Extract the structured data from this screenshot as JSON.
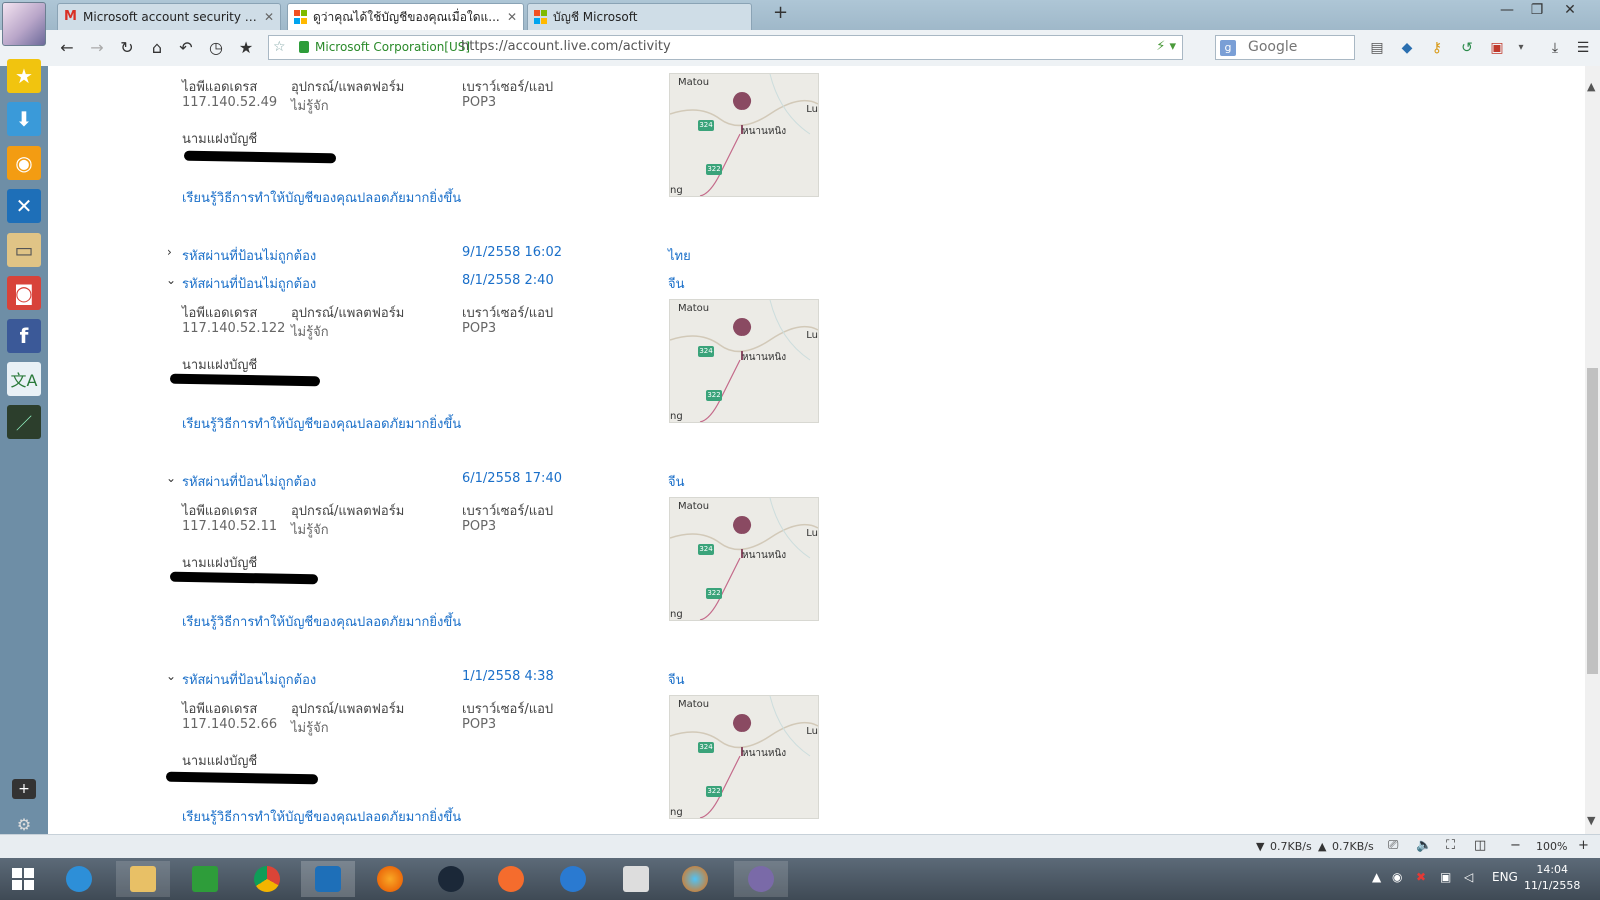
{
  "tabs": [
    {
      "title": "Microsoft account security code...",
      "icon": "gmail-icon"
    },
    {
      "title": "ดูว่าคุณได้ใช้บัญชีของคุณเมื่อใดแ...",
      "icon": "microsoft-logo-icon"
    },
    {
      "title": "บัญชี Microsoft",
      "icon": "microsoft-logo-icon"
    }
  ],
  "address": {
    "site_identity": "Microsoft Corporation[US]",
    "url": "https://account.live.com/activity"
  },
  "search": {
    "placeholder": "Google"
  },
  "activity": {
    "ip_label": "ไอพีแอดเดรส",
    "device_label": "อุปกรณ์/แพลตฟอร์ม",
    "browser_label": "เบราว์เซอร์/แอป",
    "alias_label": "นามแฝงบัญชี",
    "learn_link": "เรียนรู้วิธีการทำให้บัญชีของคุณปลอดภัยมากยิ่งขึ้น",
    "first_entry": {
      "ip": "117.140.52.49",
      "device": "ไม่รู้จัก",
      "browser": "POP3"
    },
    "collapsed_entry": {
      "event": "รหัสผ่านที่ป้อนไม่ถูกต้อง",
      "datetime": "9/1/2558 16:02",
      "location": "ไทย"
    },
    "entries": [
      {
        "event": "รหัสผ่านที่ป้อนไม่ถูกต้อง",
        "datetime": "8/1/2558 2:40",
        "location": "จีน",
        "ip": "117.140.52.122",
        "device": "ไม่รู้จัก",
        "browser": "POP3"
      },
      {
        "event": "รหัสผ่านที่ป้อนไม่ถูกต้อง",
        "datetime": "6/1/2558 17:40",
        "location": "จีน",
        "ip": "117.140.52.11",
        "device": "ไม่รู้จัก",
        "browser": "POP3"
      },
      {
        "event": "รหัสผ่านที่ป้อนไม่ถูกต้อง",
        "datetime": "1/1/2558 4:38",
        "location": "จีน",
        "ip": "117.140.52.66",
        "device": "ไม่รู้จัก",
        "browser": "POP3"
      }
    ],
    "map": {
      "town": "Matou",
      "place": "หนานหนิง",
      "edge_label": "Lu",
      "bottom_label": "ng",
      "route_a": "324",
      "route_b": "322"
    }
  },
  "statusbar": {
    "down": "0.7KB/s",
    "up": "0.7KB/s",
    "zoom": "100%"
  },
  "taskbar": {
    "lang": "ENG",
    "time": "14:04",
    "date": "11/1/2558"
  },
  "colors": {
    "link": "#1a6fc9",
    "sidebar": "#6e8ea6",
    "pin": "#8a4a62"
  }
}
